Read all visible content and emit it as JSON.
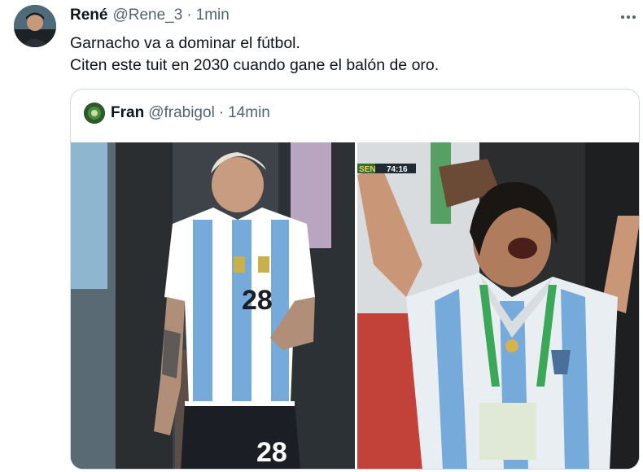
{
  "tweet": {
    "author_name": "René",
    "author_handle": "@Rene_3",
    "separator": "·",
    "time": "1min",
    "text_lines": [
      "Garnacho va a dominar el fútbol.",
      "Citen este tuit en 2030 cuando gane el balón de oro."
    ]
  },
  "quoted_tweet": {
    "author_name": "Fran",
    "author_handle": "@frabigol",
    "separator": "·",
    "time": "14min",
    "images": [
      {
        "jersey_number": "28",
        "shorts_number": "28"
      },
      {
        "scoreboard_teams": "SEN",
        "scoreboard_clock": "74:16"
      }
    ]
  },
  "icons": {
    "more": "more-horizontal-icon",
    "avatar": "user-avatar",
    "quoted_avatar": "user-avatar"
  },
  "colors": {
    "text_primary": "#0f1419",
    "text_secondary": "#536471",
    "border": "#cfd9de",
    "argentina_sky_blue": "#75aadb"
  }
}
